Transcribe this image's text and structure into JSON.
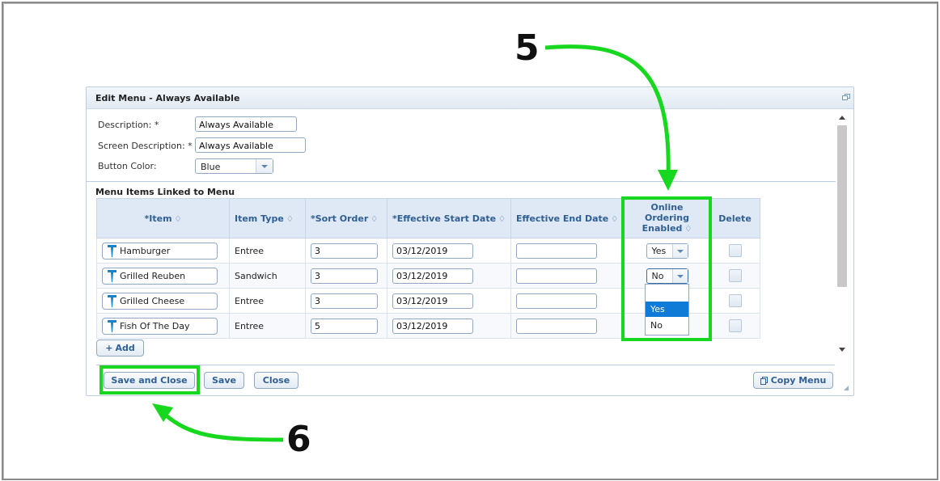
{
  "dialog": {
    "title": "Edit Menu - Always Available"
  },
  "form": {
    "description_label": "Description: *",
    "description_value": "Always Available",
    "screen_description_label": "Screen Description: *",
    "screen_description_value": "Always Available",
    "button_color_label": "Button Color:",
    "button_color_value": "Blue"
  },
  "section_title": "Menu Items Linked to Menu",
  "table": {
    "columns": [
      "*Item",
      "Item Type",
      "*Sort Order",
      "*Effective Start Date",
      "Effective End Date",
      "Online Ordering Enabled",
      "Delete"
    ],
    "online_header_lines": [
      "Online",
      "Ordering",
      "Enabled"
    ],
    "sort_glyph": "♢",
    "rows": [
      {
        "item": "Hamburger",
        "type": "Entree",
        "sort": "3",
        "start": "03/12/2019",
        "end": "",
        "online": "Yes"
      },
      {
        "item": "Grilled Reuben",
        "type": "Sandwich",
        "sort": "3",
        "start": "03/12/2019",
        "end": "",
        "online": "No"
      },
      {
        "item": "Grilled Cheese",
        "type": "Entree",
        "sort": "3",
        "start": "03/12/2019",
        "end": "",
        "online": ""
      },
      {
        "item": "Fish Of The Day",
        "type": "Entree",
        "sort": "5",
        "start": "03/12/2019",
        "end": "",
        "online": ""
      }
    ]
  },
  "dropdown_options": [
    "",
    "Yes",
    "No"
  ],
  "buttons": {
    "add": "Add",
    "save_and_close": "Save and Close",
    "save": "Save",
    "close": "Close",
    "copy_menu": "Copy Menu"
  },
  "annotations": {
    "step5": "5",
    "step6": "6",
    "highlight_color": "#17d81f"
  }
}
